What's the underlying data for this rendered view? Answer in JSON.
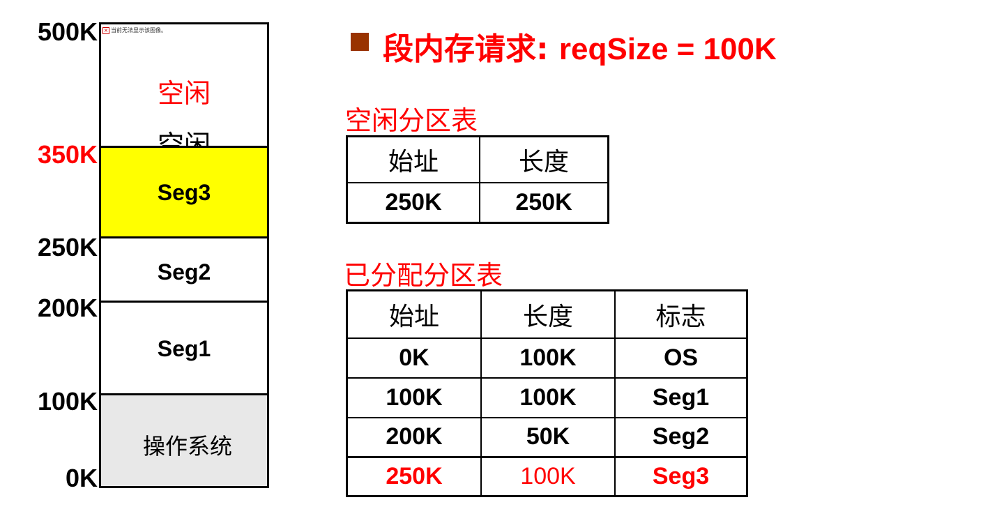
{
  "title": {
    "bullet_color": "#993300",
    "text_cjk": "段内存请求: ",
    "text_en": "reqSize = 100K"
  },
  "memory": {
    "broken_image_text": "当前无法显示该图像。",
    "addresses": [
      "500K",
      "350K",
      "250K",
      "200K",
      "100K",
      "0K"
    ],
    "highlight_address": "350K",
    "blocks": [
      {
        "label": "空闲",
        "label2": "空闲",
        "color": "#ffffff"
      },
      {
        "label": "Seg3",
        "color": "#ffff00"
      },
      {
        "label": "Seg2",
        "color": "#ffffff"
      },
      {
        "label": "Seg1",
        "color": "#ffffff"
      },
      {
        "label": "操作系统",
        "color": "#e8e8e8"
      }
    ]
  },
  "free_table": {
    "caption": "空闲分区表",
    "headers": [
      "始址",
      "长度"
    ],
    "rows": [
      [
        "250K",
        "250K"
      ]
    ]
  },
  "alloc_table": {
    "caption": "已分配分区表",
    "headers": [
      "始址",
      "长度",
      "标志"
    ],
    "rows": [
      [
        "0K",
        "100K",
        "OS"
      ],
      [
        "100K",
        "100K",
        "Seg1"
      ],
      [
        "200K",
        "50K",
        "Seg2"
      ],
      [
        "250K",
        "100K",
        "Seg3"
      ]
    ]
  },
  "colors": {
    "accent_red": "#ff0000",
    "seg3_fill": "#ffff00",
    "os_fill": "#e8e8e8"
  }
}
